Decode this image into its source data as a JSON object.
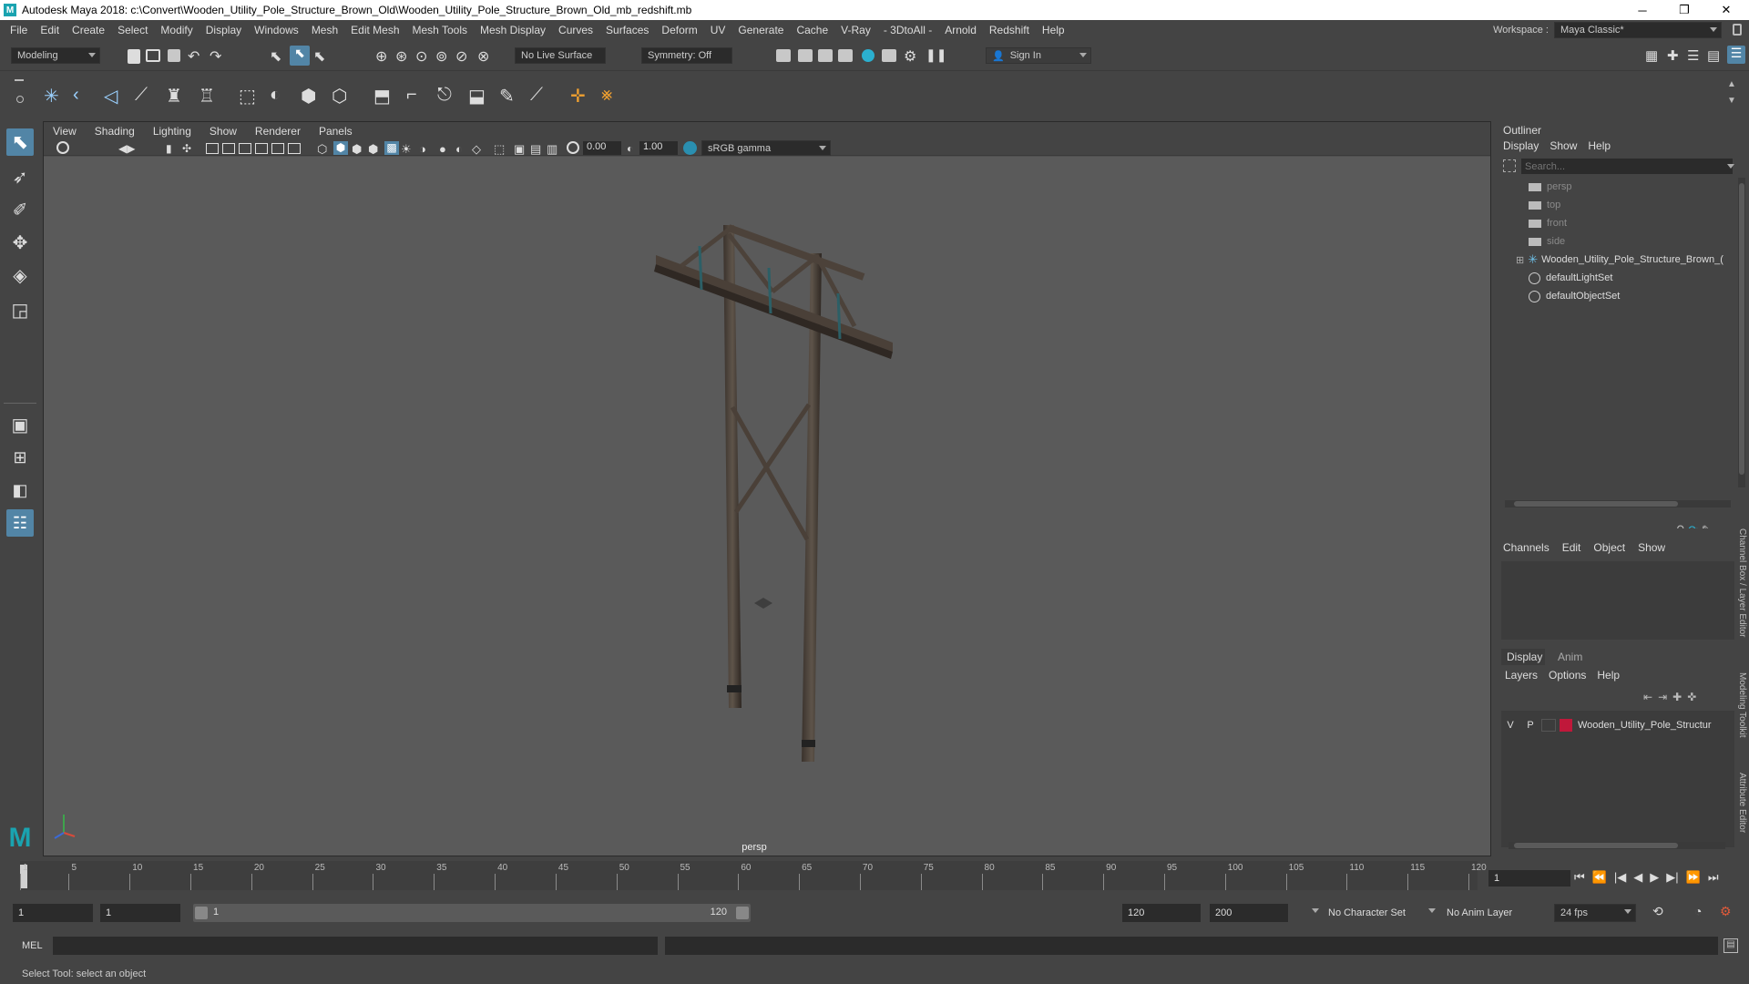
{
  "window": {
    "title": "Autodesk Maya 2018: c:\\Convert\\Wooden_Utility_Pole_Structure_Brown_Old\\Wooden_Utility_Pole_Structure_Brown_Old_mb_redshift.mb",
    "controls": [
      "─",
      "❐",
      "✕"
    ]
  },
  "menubar": {
    "items": [
      "File",
      "Edit",
      "Create",
      "Select",
      "Modify",
      "Display",
      "Windows",
      "Mesh",
      "Edit Mesh",
      "Mesh Tools",
      "Mesh Display",
      "Curves",
      "Surfaces",
      "Deform",
      "UV",
      "Generate",
      "Cache",
      "V-Ray",
      "- 3DtoAll -",
      "Arnold",
      "Redshift",
      "Help"
    ],
    "workspace_label": "Workspace :",
    "workspace_value": "Maya Classic*"
  },
  "statusline": {
    "mode": "Modeling",
    "live_surface": "No Live Surface",
    "symmetry": "Symmetry: Off",
    "sign_in": "Sign In"
  },
  "viewport": {
    "menu": [
      "View",
      "Shading",
      "Lighting",
      "Show",
      "Renderer",
      "Panels"
    ],
    "exposure": "0.00",
    "gamma": "1.00",
    "color_space": "sRGB gamma",
    "camera_label": "persp"
  },
  "outliner": {
    "title": "Outliner",
    "menu": [
      "Display",
      "Show",
      "Help"
    ],
    "search_placeholder": "Search...",
    "items": [
      {
        "label": "persp",
        "icon": "camera-icon",
        "dim": true
      },
      {
        "label": "top",
        "icon": "camera-icon",
        "dim": true
      },
      {
        "label": "front",
        "icon": "camera-icon",
        "dim": true
      },
      {
        "label": "side",
        "icon": "camera-icon",
        "dim": true
      },
      {
        "label": "Wooden_Utility_Pole_Structure_Brown_(",
        "icon": "group-icon",
        "dim": false,
        "expand": "⊞"
      },
      {
        "label": "defaultLightSet",
        "icon": "set-icon",
        "dim": false
      },
      {
        "label": "defaultObjectSet",
        "icon": "set-icon",
        "dim": false
      }
    ]
  },
  "channelbox": {
    "menu": [
      "Channels",
      "Edit",
      "Object",
      "Show"
    ]
  },
  "layers": {
    "tabs": [
      "Display",
      "Anim"
    ],
    "menu": [
      "Layers",
      "Options",
      "Help"
    ],
    "row": {
      "v": "V",
      "p": "P",
      "name": "Wooden_Utility_Pole_Structur",
      "color": "#c0183a"
    }
  },
  "side_tabs": [
    "Channel Box / Layer Editor",
    "Modeling Toolkit",
    "Attribute Editor"
  ],
  "timeline": {
    "ticks": [
      "1",
      "5",
      "10",
      "15",
      "20",
      "25",
      "30",
      "35",
      "40",
      "45",
      "50",
      "55",
      "60",
      "65",
      "70",
      "75",
      "80",
      "85",
      "90",
      "95",
      "100",
      "105",
      "110",
      "115",
      "120"
    ],
    "current_frame": "1"
  },
  "range": {
    "start": "1",
    "start2": "1",
    "slider_start": "1",
    "slider_end": "120",
    "end": "120",
    "end2": "200",
    "character_set": "No Character Set",
    "anim_layer": "No Anim Layer",
    "fps": "24 fps"
  },
  "cmdline": {
    "label": "MEL"
  },
  "helpline": {
    "text": "Select Tool: select an object"
  }
}
